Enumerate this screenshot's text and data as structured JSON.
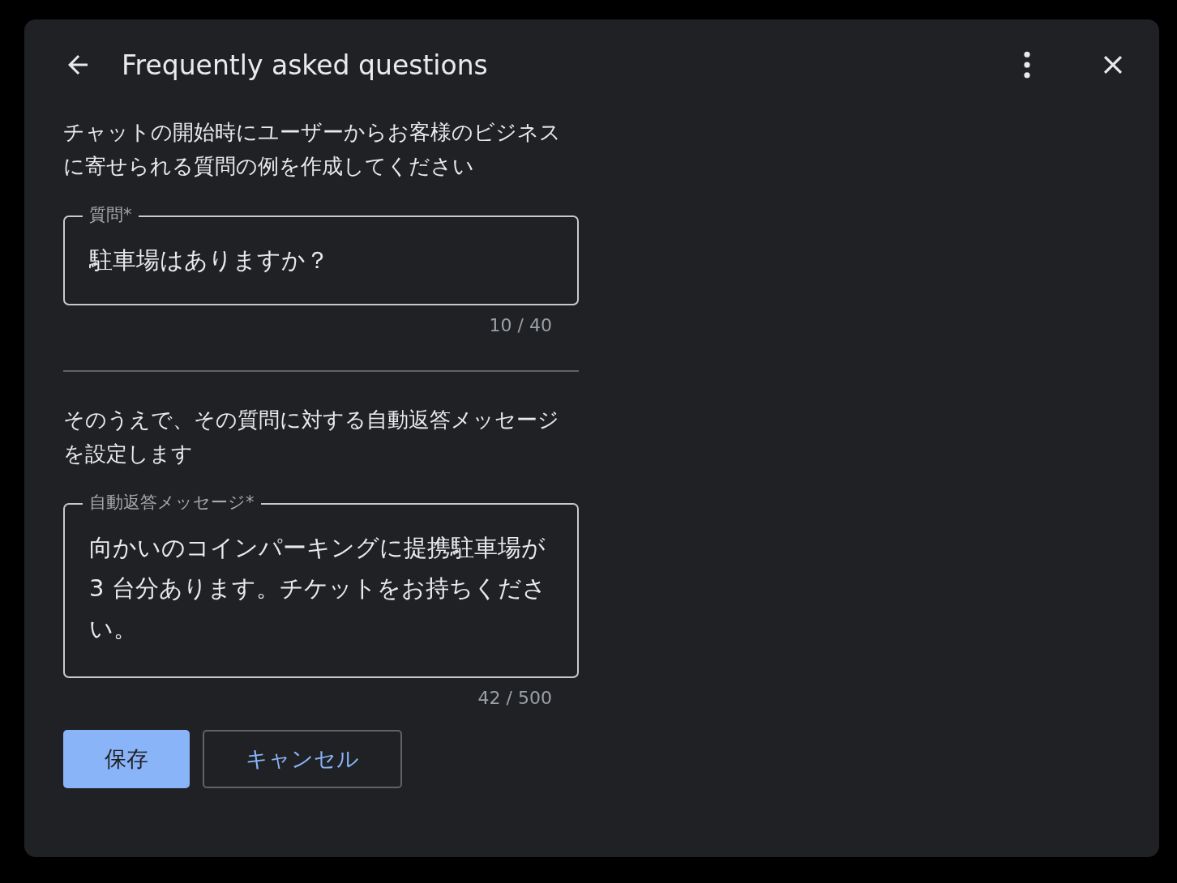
{
  "dialog": {
    "title": "Frequently asked questions"
  },
  "sections": [
    {
      "instruction": "チャットの開始時にユーザーからお客様のビジネスに寄せられる質問の例を作成してください",
      "field": {
        "kind": "single",
        "label": "質問*",
        "value": "駐車場はありますか？",
        "counter": "10 / 40"
      }
    },
    {
      "instruction": "そのうえで、その質問に対する自動返答メッセージを設定します",
      "field": {
        "kind": "multi",
        "label": "自動返答メッセージ*",
        "value": "向かいのコインパーキングに提携駐車場が 3 台分あります。チケットをお持ちください。",
        "counter": "42 / 500"
      }
    }
  ],
  "buttons": [
    {
      "label": "保存",
      "kind": "primary"
    },
    {
      "label": "キャンセル",
      "kind": "outlined"
    }
  ]
}
